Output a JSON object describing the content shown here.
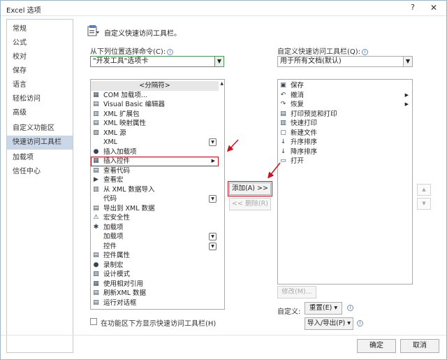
{
  "window": {
    "title": "Excel 选项",
    "help": "?",
    "close": "✕"
  },
  "sidebar": {
    "items": [
      {
        "label": "常规",
        "active": false
      },
      {
        "label": "公式",
        "active": false
      },
      {
        "label": "校对",
        "active": false
      },
      {
        "label": "保存",
        "active": false
      },
      {
        "label": "语言",
        "active": false
      },
      {
        "label": "轻松访问",
        "active": false
      },
      {
        "label": "高级",
        "active": false
      },
      {
        "label": "自定义功能区",
        "active": false
      },
      {
        "label": "快速访问工具栏",
        "active": true
      },
      {
        "label": "加载项",
        "active": false
      },
      {
        "label": "信任中心",
        "active": false
      }
    ]
  },
  "main": {
    "heading": "自定义快速访问工具栏。",
    "choose_label": "从下列位置选择命令(C):",
    "choose_value": "\"开发工具\"选项卡",
    "customize_label": "自定义快速访问工具栏(Q):",
    "customize_value": "用于所有文档(默认)",
    "commands": [
      {
        "label": "<分隔符>",
        "icon": "",
        "separator": true
      },
      {
        "label": "COM 加载项...",
        "icon": "▦"
      },
      {
        "label": "Visual Basic 编辑器",
        "icon": "▤"
      },
      {
        "label": "XML 扩展包",
        "icon": "▥"
      },
      {
        "label": "XML 映射属性",
        "icon": "▤"
      },
      {
        "label": "XML 源",
        "icon": "▧"
      },
      {
        "label": "XML",
        "icon": "",
        "dropdown": true
      },
      {
        "label": "插入加载项",
        "icon": "●"
      },
      {
        "label": "插入控件",
        "icon": "▦",
        "submenu": true,
        "highlight": true
      },
      {
        "label": "查看代码",
        "icon": "▤"
      },
      {
        "label": "查看宏",
        "icon": "▶"
      },
      {
        "label": "从 XML 数据导入",
        "icon": "▥"
      },
      {
        "label": "代码",
        "icon": "",
        "dropdown": true
      },
      {
        "label": "导出到 XML 数据",
        "icon": "▤"
      },
      {
        "label": "宏安全性",
        "icon": "⚠"
      },
      {
        "label": "加载项",
        "icon": "✱"
      },
      {
        "label": "加载项",
        "icon": "",
        "dropdown": true
      },
      {
        "label": "控件",
        "icon": "",
        "dropdown": true
      },
      {
        "label": "控件属性",
        "icon": "▤"
      },
      {
        "label": "录制宏",
        "icon": "●"
      },
      {
        "label": "设计模式",
        "icon": "▨"
      },
      {
        "label": "使用相对引用",
        "icon": "▦"
      },
      {
        "label": "刷新XML 数据",
        "icon": "▤"
      },
      {
        "label": "运行对话框",
        "icon": "▤"
      }
    ],
    "toolbar_items": [
      {
        "label": "保存",
        "icon": "▣"
      },
      {
        "label": "撤消",
        "icon": "↶",
        "submenu": true
      },
      {
        "label": "恢复",
        "icon": "↷",
        "submenu": true
      },
      {
        "label": "打印预览和打印",
        "icon": "▤"
      },
      {
        "label": "快速打印",
        "icon": "▥"
      },
      {
        "label": "新建文件",
        "icon": "▢"
      },
      {
        "label": "升序排序",
        "icon": "↓"
      },
      {
        "label": "降序排序",
        "icon": "↓"
      },
      {
        "label": "打开",
        "icon": "▭"
      }
    ],
    "add_button": "添加(A) >>",
    "remove_button": "<< 删除(R)",
    "modify_button": "修改(M)...",
    "customize_text": "自定义:",
    "reset_button": "重置(E) ▾",
    "import_export_button": "导入/导出(P) ▾",
    "show_below_label": "在功能区下方显示快速访问工具栏(H)",
    "move_up": "▲",
    "move_down": "▼"
  },
  "footer": {
    "ok": "确定",
    "cancel": "取消"
  },
  "colors": {
    "accent": "#d0101a",
    "active_nav": "#c9d7e8"
  }
}
